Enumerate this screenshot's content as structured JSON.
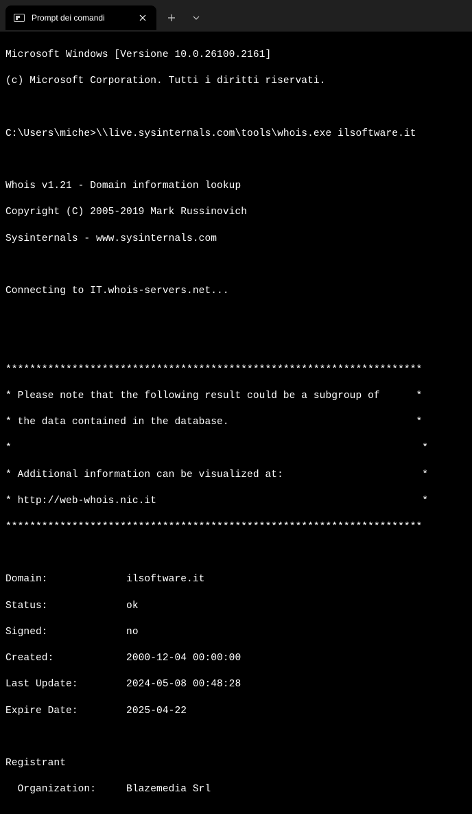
{
  "titlebar": {
    "tab_title": "Prompt dei comandi"
  },
  "terminal": {
    "l0": "Microsoft Windows [Versione 10.0.26100.2161]",
    "l1": "(c) Microsoft Corporation. Tutti i diritti riservati.",
    "l2": "",
    "l3": "C:\\Users\\miche>\\\\live.sysinternals.com\\tools\\whois.exe ilsoftware.it",
    "l4": "",
    "l5": "Whois v1.21 - Domain information lookup",
    "l6": "Copyright (C) 2005-2019 Mark Russinovich",
    "l7": "Sysinternals - www.sysinternals.com",
    "l8": "",
    "l9": "Connecting to IT.whois-servers.net...",
    "l10": "",
    "l11": "",
    "l12": "*********************************************************************",
    "l13": "* Please note that the following result could be a subgroup of      *",
    "l14": "* the data contained in the database.                               *",
    "l15": "*                                                                    *",
    "l16": "* Additional information can be visualized at:                       *",
    "l17": "* http://web-whois.nic.it                                            *",
    "l18": "*********************************************************************",
    "l19": "",
    "l20": "Domain:             ilsoftware.it",
    "l21": "Status:             ok",
    "l22": "Signed:             no",
    "l23": "Created:            2000-12-04 00:00:00",
    "l24": "Last Update:        2024-05-08 00:48:28",
    "l25": "Expire Date:        2025-04-22",
    "l26": "",
    "l27": "Registrant",
    "l28": "  Organization:     Blazemedia Srl"
  }
}
